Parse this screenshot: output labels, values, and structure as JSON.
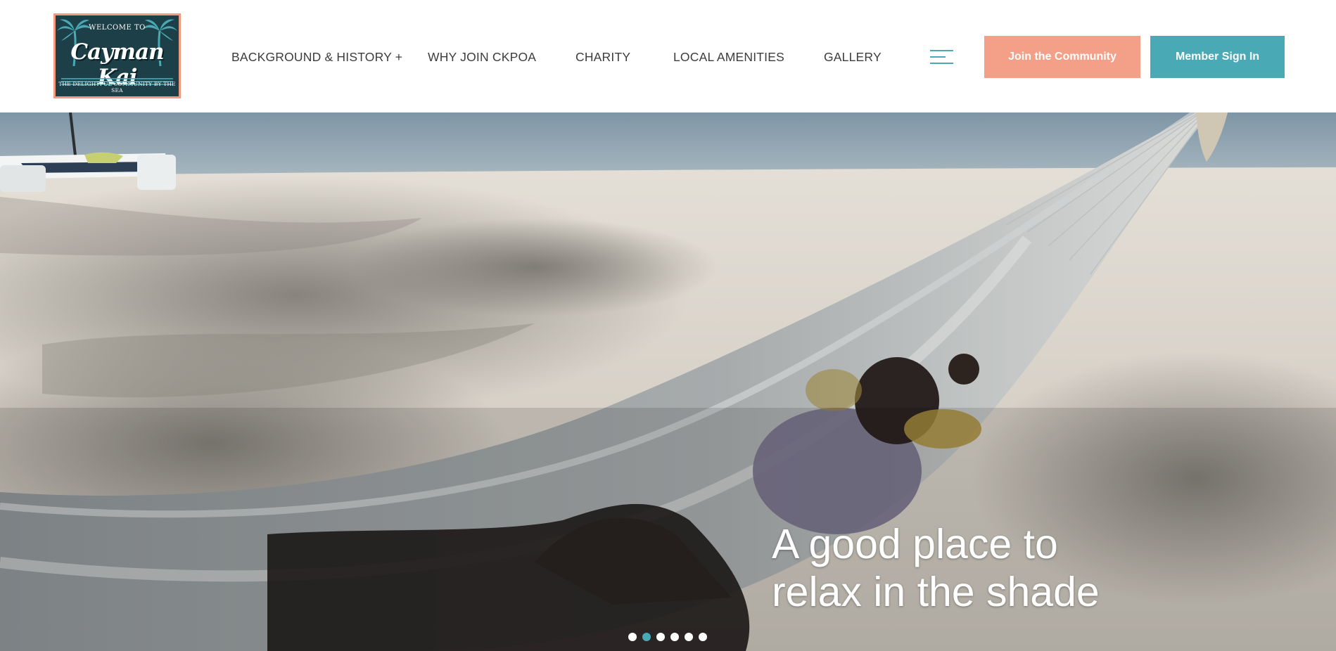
{
  "logo": {
    "welcome": "WELCOME TO",
    "name": "Cayman Kai",
    "tagline": "THE DELIGHTFUL COMMUNITY BY THE SEA",
    "icon": "palm-tree-icon"
  },
  "nav": {
    "items": [
      {
        "label": "BACKGROUND & HISTORY +"
      },
      {
        "label": "WHY JOIN CKPOA"
      },
      {
        "label": "CHARITY"
      },
      {
        "label": "LOCAL AMENITIES"
      },
      {
        "label": "GALLERY"
      }
    ],
    "menu_icon": "hamburger-menu-icon"
  },
  "buttons": {
    "join": "Join the Community",
    "signin": "Member Sign In"
  },
  "hero": {
    "caption_line1": "A good place to",
    "caption_line2": "relax in the shade",
    "slides": 6,
    "active_slide": 2
  },
  "colors": {
    "accent_teal": "#49aab5",
    "accent_salmon": "#f4a088",
    "nav_text": "#3c3c3c",
    "logo_bg": "#1d3f47"
  }
}
